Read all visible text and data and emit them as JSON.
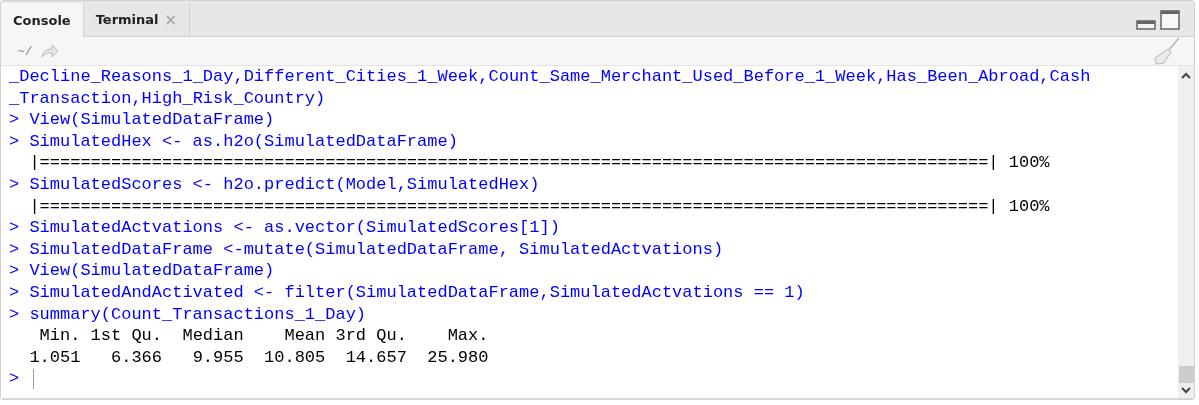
{
  "tabs": [
    {
      "label": "Console",
      "selected": true
    },
    {
      "label": "Terminal",
      "selected": false,
      "close_glyph": "×"
    }
  ],
  "toolbar": {
    "path": "~/"
  },
  "console": {
    "lines": [
      {
        "kind": "input",
        "text": "_Decline_Reasons_1_Day,Different_Cities_1_Week,Count_Same_Merchant_Used_Before_1_Week,Has_Been_Abroad,Cash"
      },
      {
        "kind": "input",
        "text": "_Transaction,High_Risk_Country)"
      },
      {
        "kind": "input",
        "prompt": ">",
        "text": "View(SimulatedDataFrame)"
      },
      {
        "kind": "input",
        "prompt": ">",
        "text": "SimulatedHex <- as.h2o(SimulatedDataFrame)"
      },
      {
        "kind": "output",
        "text": "  |=============================================================================================| 100%"
      },
      {
        "kind": "input",
        "prompt": ">",
        "text": "SimulatedScores <- h2o.predict(Model,SimulatedHex)"
      },
      {
        "kind": "output",
        "text": "  |=============================================================================================| 100%"
      },
      {
        "kind": "input",
        "prompt": ">",
        "text": "SimulatedActvations <- as.vector(SimulatedScores[1])"
      },
      {
        "kind": "input",
        "prompt": ">",
        "text": "SimulatedDataFrame <-mutate(SimulatedDataFrame, SimulatedActvations)"
      },
      {
        "kind": "input",
        "prompt": ">",
        "text": "View(SimulatedDataFrame)"
      },
      {
        "kind": "input",
        "prompt": ">",
        "text": "SimulatedAndActivated <- filter(SimulatedDataFrame,SimulatedActvations == 1)"
      },
      {
        "kind": "input",
        "prompt": ">",
        "text": "summary(Count_Transactions_1_Day)"
      },
      {
        "kind": "output",
        "text": "   Min. 1st Qu.  Median    Mean 3rd Qu.    Max. "
      },
      {
        "kind": "output",
        "text": "  1.051   6.366   9.955  10.805  14.657  25.980 "
      }
    ],
    "prompt": ">"
  }
}
